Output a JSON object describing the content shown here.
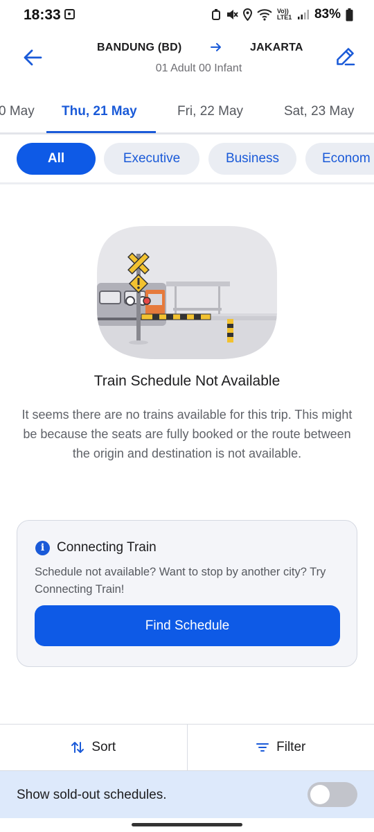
{
  "status_bar": {
    "time": "18:33",
    "battery_pct": "83%",
    "network_label": "Vo)) LTE1"
  },
  "header": {
    "origin": "BANDUNG (BD)",
    "destination": "JAKARTA",
    "passengers": "01 Adult 00 Infant"
  },
  "date_tabs": [
    {
      "label": "0 May",
      "active": false
    },
    {
      "label": "Thu, 21 May",
      "active": true
    },
    {
      "label": "Fri, 22 May",
      "active": false
    },
    {
      "label": "Sat, 23 May",
      "active": false
    }
  ],
  "class_chips": [
    {
      "label": "All",
      "active": true
    },
    {
      "label": "Executive",
      "active": false
    },
    {
      "label": "Business",
      "active": false
    },
    {
      "label": "Econom",
      "active": false
    }
  ],
  "empty_state": {
    "title": "Train Schedule Not Available",
    "description": "It seems there are no trains available for this trip. This might be because the seats are fully booked or the route between the origin and destination is not available."
  },
  "connecting_card": {
    "title": "Connecting Train",
    "description": "Schedule not available? Want to stop by another city? Try Connecting Train!",
    "button_label": "Find Schedule"
  },
  "bottom_bar": {
    "sort_label": "Sort",
    "filter_label": "Filter"
  },
  "sold_out": {
    "label": "Show sold-out schedules.",
    "enabled": false
  },
  "colors": {
    "accent": "#0e5ae6",
    "link_blue": "#1a5ad8",
    "chip_bg": "#eaedf3",
    "toggle_bar_bg": "#dde9fb"
  },
  "icons": [
    "back-arrow-icon",
    "edit-pencil-icon",
    "route-arrow-icon",
    "info-icon",
    "sort-icon",
    "filter-icon"
  ]
}
